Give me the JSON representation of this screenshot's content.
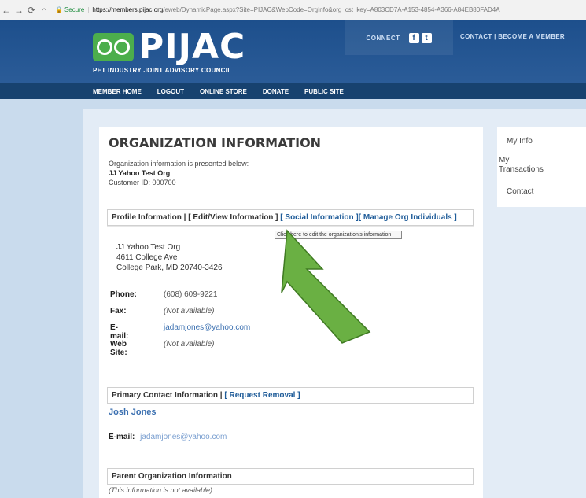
{
  "browser": {
    "secure_label": "Secure",
    "url_host": "https://members.pijac.org",
    "url_path": "/eweb/DynamicPage.aspx?Site=PIJAC&WebCode=OrgInfo&org_cst_key=A803CD7A-A153-4854-A366-A84EB80FAD4A"
  },
  "header": {
    "logo_text": "PIJAC",
    "logo_subtitle": "PET INDUSTRY JOINT ADVISORY COUNCIL",
    "connect_label": "CONNECT",
    "social_icons": [
      "facebook-icon",
      "twitter-icon"
    ],
    "top_links": "CONTACT | BECOME A MEMBER",
    "brand_color": "#1d4f8c",
    "logo_green": "#4cae4c"
  },
  "subnav": {
    "items": [
      "MEMBER HOME",
      "LOGOUT",
      "ONLINE STORE",
      "DONATE",
      "PUBLIC SITE"
    ]
  },
  "main": {
    "title": "ORGANIZATION INFORMATION",
    "intro": "Organization information is presented below:",
    "org_name": "JJ Yahoo Test Org",
    "customer_id": "Customer ID: 000700",
    "profile_section": {
      "label": "Profile Information |",
      "edit_link": "[ Edit/View Information ]",
      "social_link": "[ Social Information ]",
      "manage_link": "[ Manage Org Individuals ]"
    },
    "tooltip": "Click here to edit the organization's information",
    "address": [
      "JJ Yahoo Test Org",
      "4611 College Ave",
      "College Park, MD 20740-3426"
    ],
    "fields": {
      "phone_label": "Phone:",
      "phone_value": "(608) 609-9221",
      "fax_label": "Fax:",
      "fax_value": "(Not available)",
      "email_label": "E-mail:",
      "email_value": "jadamjones@yahoo.com",
      "web_label": "Web Site:",
      "web_value": "(Not available)"
    },
    "primary_contact": {
      "label": "Primary Contact Information |",
      "remove_link": "[ Request Removal ]",
      "name": "Josh Jones",
      "email_label": "E-mail:",
      "email_value": "jadamjones@yahoo.com"
    },
    "parent_org": {
      "label": "Parent Organization Information",
      "note": "(This information is not available)"
    }
  },
  "sidebar": {
    "items": [
      "My Info",
      "My Transactions",
      "Contact"
    ]
  },
  "annotation": {
    "arrow_color": "#6ab043"
  }
}
